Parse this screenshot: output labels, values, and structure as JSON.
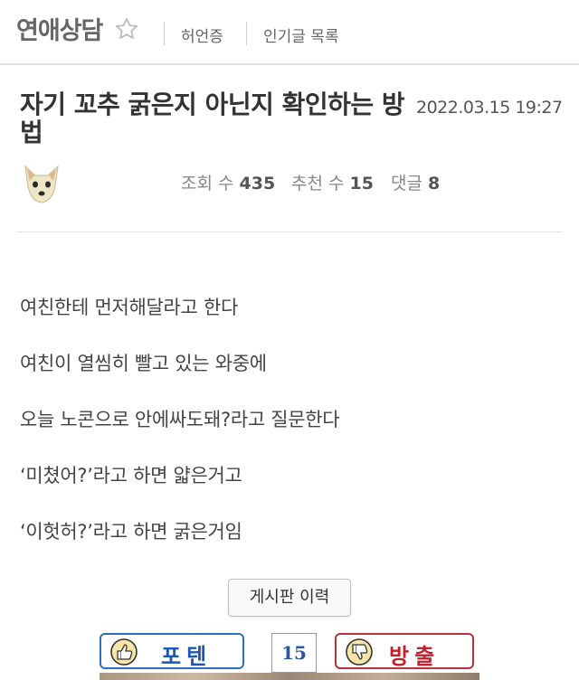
{
  "header": {
    "board_title": "연애상담",
    "links": [
      "허언증",
      "인기글 목록"
    ]
  },
  "post": {
    "title": "자기 꼬추 굵은지 아닌지 확인하는 방법",
    "date": "2022.03.15 19:27",
    "stats": [
      {
        "label": "조회 수",
        "value": "435"
      },
      {
        "label": "추천 수",
        "value": "15"
      },
      {
        "label": "댓글",
        "value": "8"
      }
    ],
    "body": [
      "여친한테 먼저해달라고 한다",
      "여친이 열씸히 빨고 있는 와중에",
      "오늘 노콘으로 안에싸도돼?라고 질문한다",
      "‘미쳤어?’라고 하면 얇은거고",
      "‘이헛허?’라고 하면 굵은거임"
    ]
  },
  "actions": {
    "history_label": "게시판 이력",
    "upvote_label": "포텐",
    "downvote_label": "방출",
    "vote_count": "15"
  },
  "icons": {
    "favorite": "star-icon",
    "upvote": "thumbs-up-icon",
    "downvote": "thumbs-down-icon"
  },
  "colors": {
    "upvote": "#2b6fc4",
    "downvote": "#b8323b",
    "vote_count": "#2b55a8"
  }
}
